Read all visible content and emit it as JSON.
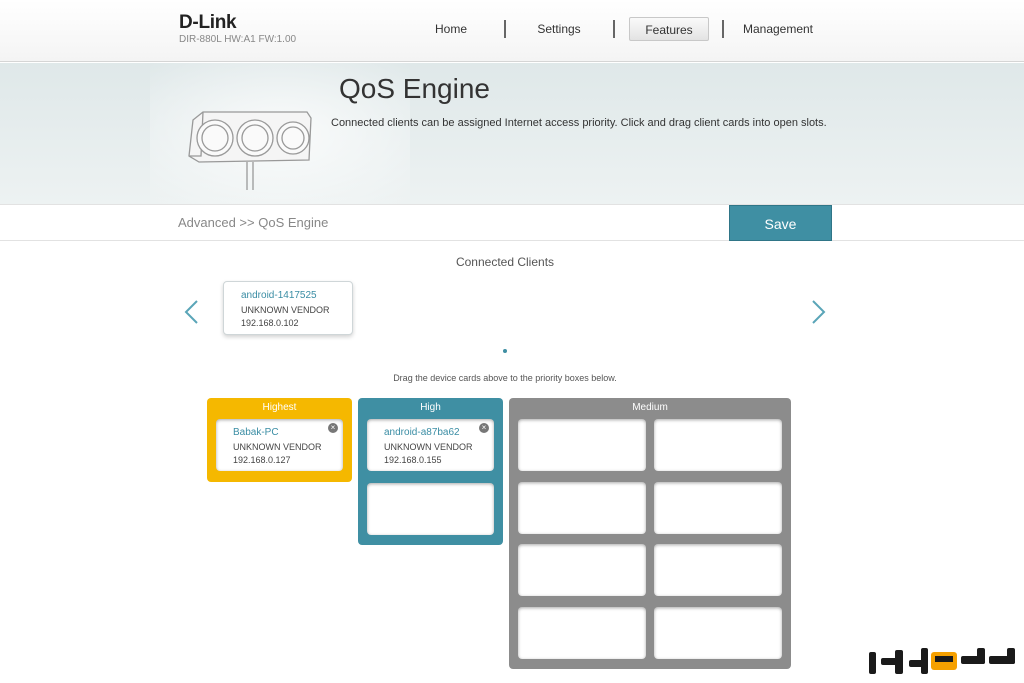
{
  "header": {
    "logo": "D-Link",
    "model_info": "DIR-880L   HW:A1   FW:1.00",
    "nav": [
      {
        "label": "Home",
        "active": false
      },
      {
        "label": "Settings",
        "active": false
      },
      {
        "label": "Features",
        "active": true
      },
      {
        "label": "Management",
        "active": false
      }
    ]
  },
  "banner": {
    "title": "QoS Engine",
    "description": "Connected clients can be assigned Internet access priority. Click and drag client cards into open slots."
  },
  "breadcrumb": "Advanced >> QoS Engine",
  "save_label": "Save",
  "connected_clients": {
    "title": "Connected Clients",
    "cards": [
      {
        "name": "android-1417525",
        "vendor": "UNKNOWN VENDOR",
        "ip": "192.168.0.102"
      }
    ],
    "hint": "Drag the device cards above to the priority boxes below."
  },
  "priority": {
    "highest": {
      "label": "Highest",
      "color": "#f5b800",
      "cards": [
        {
          "name": "Babak-PC",
          "vendor": "UNKNOWN VENDOR",
          "ip": "192.168.0.127"
        }
      ]
    },
    "high": {
      "label": "High",
      "color": "#3f8fa3",
      "cards": [
        {
          "name": "android-a87ba62",
          "vendor": "UNKNOWN VENDOR",
          "ip": "192.168.0.155"
        }
      ]
    },
    "medium": {
      "label": "Medium",
      "color": "#8c8c8c",
      "cards": []
    }
  },
  "icons": {
    "prev": "chevron-left-icon",
    "next": "chevron-right-icon",
    "remove": "close-circle-icon",
    "banner": "traffic-light-icon"
  }
}
